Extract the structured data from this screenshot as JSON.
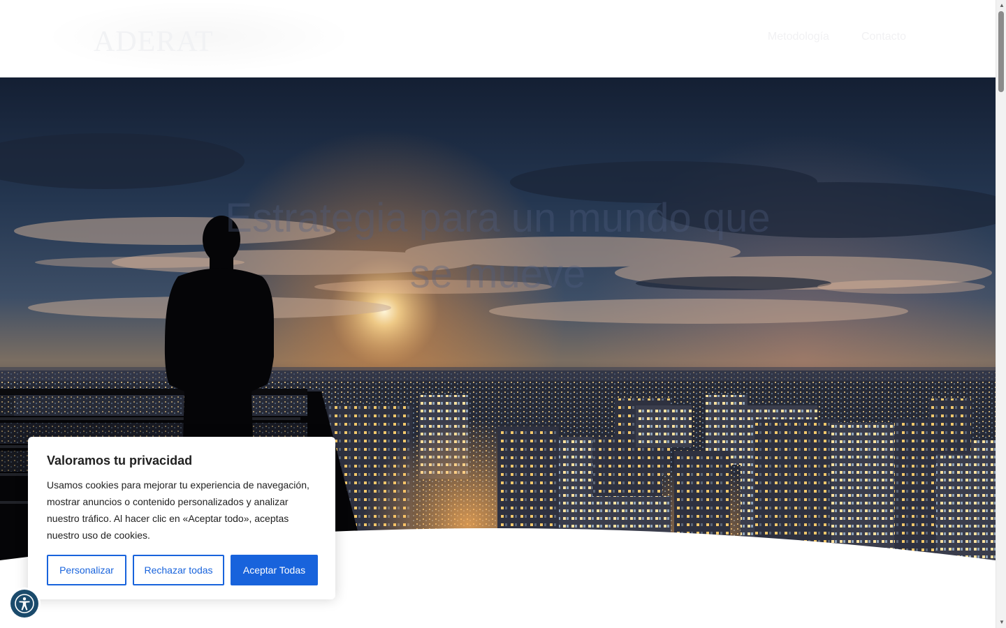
{
  "header": {
    "logo_text": "ADERAT",
    "nav": [
      {
        "label": "Metodología"
      },
      {
        "label": "Contacto"
      }
    ]
  },
  "hero": {
    "title_line1": "Estrategia para un mundo que",
    "title_line2": "se mueve"
  },
  "cookie_banner": {
    "title": "Valoramos tu privacidad",
    "body": "Usamos cookies para mejorar tu experiencia de navegación, mostrar anuncios o contenido personalizados y analizar nuestro tráfico. Al hacer clic en «Aceptar todo», aceptas nuestro uso de cookies.",
    "customize_label": "Personalizar",
    "reject_label": "Rechazar todas",
    "accept_label": "Aceptar Todas"
  },
  "accessibility": {
    "icon": "accessibility-icon"
  },
  "colors": {
    "accent": "#1863dc",
    "accessibility_bg": "#1a4a6b",
    "hero_sky_top": "#1c2a40",
    "hero_sunset": "#f2a24a"
  }
}
